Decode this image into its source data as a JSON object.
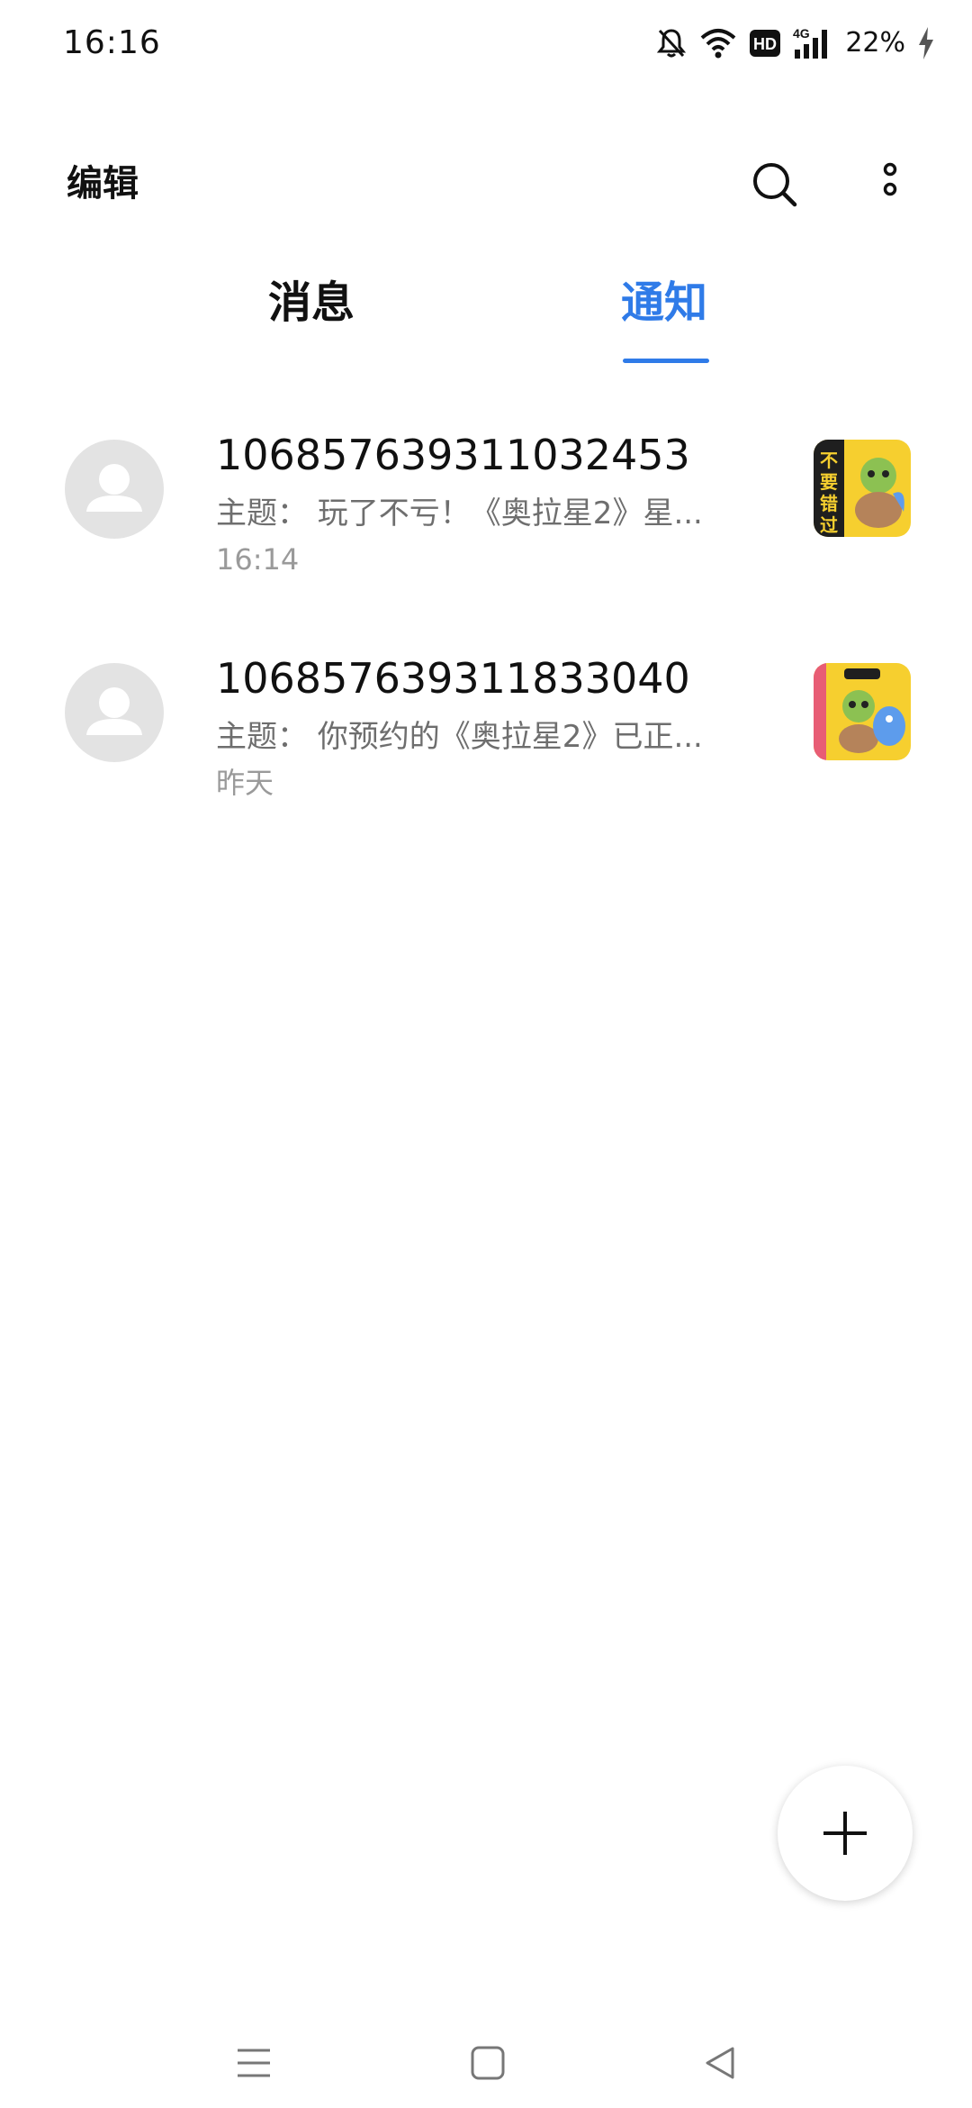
{
  "status_bar": {
    "time": "16:16",
    "battery": "22%",
    "network": "4G",
    "hd_badge": "HD",
    "icons": [
      "mute-bell-icon",
      "wifi-icon",
      "hd-icon",
      "cellular-signal-icon",
      "charging-icon"
    ]
  },
  "header": {
    "edit_label": "编辑",
    "icons": [
      "search-icon",
      "more-vertical-icon"
    ]
  },
  "tabs": [
    {
      "label": "消息",
      "active": false
    },
    {
      "label": "通知",
      "active": true
    }
  ],
  "conversations": [
    {
      "sender": "106857639311032453",
      "preview": "主题： 玩了不亏！《奥拉星2》星...",
      "time": "16:14",
      "thumb_text": "不要错过"
    },
    {
      "sender": "106857639311833040",
      "preview": "主题： 你预约的《奥拉星2》已正...",
      "time": "昨天",
      "thumb_text": ""
    }
  ],
  "fab_icon": "plus-icon",
  "nav_bar": {
    "icons": [
      "menu-icon",
      "home-square-icon",
      "back-triangle-icon"
    ]
  },
  "colors": {
    "accent": "#2f7be8",
    "text_primary": "#111111",
    "text_secondary": "#6e6e6e",
    "text_tertiary": "#9a9a9a",
    "avatar_bg": "#e3e3e3",
    "thumb_yellow": "#f6cf2f"
  }
}
